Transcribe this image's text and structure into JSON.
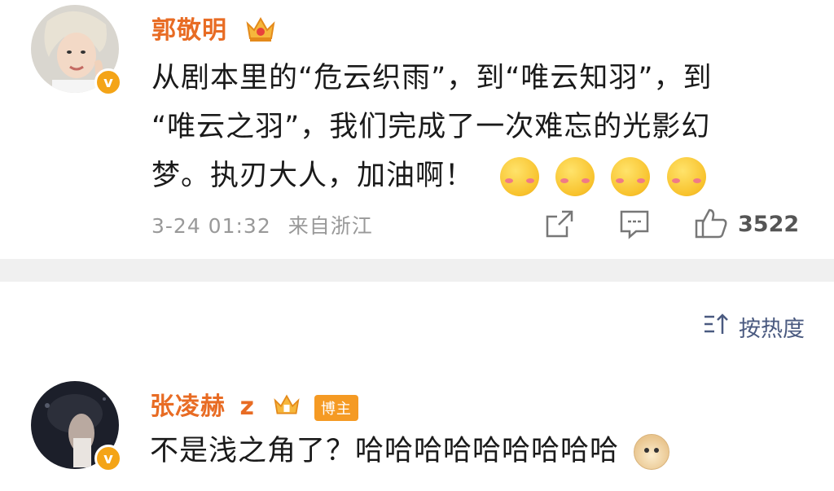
{
  "post": {
    "username": "郭敬明",
    "content_lines": [
      "从剧本里的“危云织雨”，到“唯云知羽”，到",
      "“唯云之羽”，我们完成了一次难忘的光影幻",
      "梦。执刃大人，加油啊！"
    ],
    "emoji_icons": [
      "blush-emoji-icon",
      "blush-emoji-icon",
      "blush-emoji-icon",
      "blush-emoji-icon"
    ],
    "timestamp": "3-24 01:32",
    "source": "来自浙江",
    "like_count": "3522"
  },
  "sort": {
    "label": "按热度"
  },
  "comment": {
    "username": "张凌赫",
    "username_suffix": "z",
    "badge_label": "博主",
    "text": "不是浅之角了？哈哈哈哈哈哈哈哈哈"
  },
  "colors": {
    "username": "#e86c24",
    "verified_badge": "#f4a417",
    "meta_text": "#999999",
    "sort_text": "#4a5a80",
    "divider": "#f0f0f0"
  }
}
